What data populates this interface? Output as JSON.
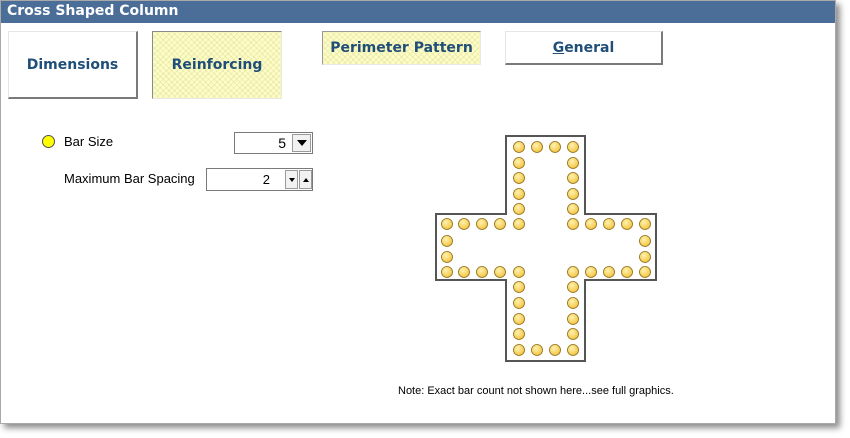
{
  "window": {
    "title": "Cross Shaped Column"
  },
  "tabs": {
    "dimensions": "Dimensions",
    "reinforcing": "Reinforcing",
    "perimeter_pattern": "Perimeter Pattern",
    "general_mnemonic": "G",
    "general_rest": "eneral"
  },
  "form": {
    "bar_size_label": "Bar Size",
    "bar_size_value": "5",
    "max_spacing_label": "Maximum Bar Spacing",
    "max_spacing_value": "2"
  },
  "graphic": {
    "bar_fill": "#f4c542",
    "outline_color": "#555555"
  },
  "note": "Note: Exact bar count not shown here...see full graphics."
}
